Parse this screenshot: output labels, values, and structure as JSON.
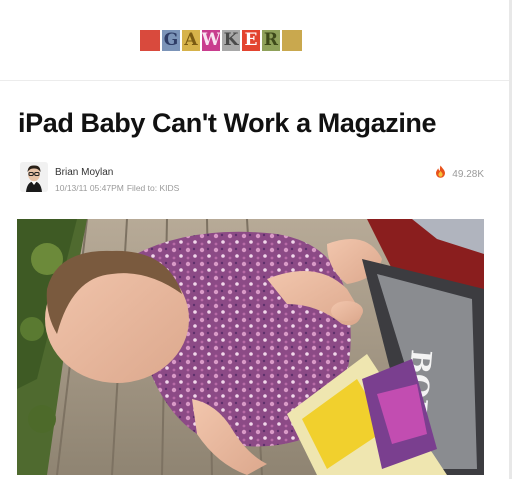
{
  "header": {
    "logo_letters": [
      {
        "char": "",
        "bg": "#d94a3d",
        "fg": "#ffffff"
      },
      {
        "char": "G",
        "bg": "#7b94b8",
        "fg": "#2e3d66"
      },
      {
        "char": "A",
        "bg": "#d6b24a",
        "fg": "#7a5a12"
      },
      {
        "char": "W",
        "bg": "#c93d8e",
        "fg": "#f8e3f0"
      },
      {
        "char": "K",
        "bg": "#a8a8a8",
        "fg": "#4a4a4a"
      },
      {
        "char": "E",
        "bg": "#e3442f",
        "fg": "#ffffff"
      },
      {
        "char": "R",
        "bg": "#8fa15a",
        "fg": "#3e4a1a"
      },
      {
        "char": "",
        "bg": "#c9a84e",
        "fg": "#ffffff"
      }
    ]
  },
  "article": {
    "title": "iPad Baby Can't Work a Magazine",
    "author": "Brian Moylan",
    "timestamp": "10/13/11 05:47PM",
    "filed_to": "Filed to: KIDS",
    "views": "49.28K",
    "views_icon": "flame-icon",
    "image_alt": "Baby in floral outfit sitting on a wooden deck holding magazines",
    "magazine_cover_text": "BOD"
  }
}
